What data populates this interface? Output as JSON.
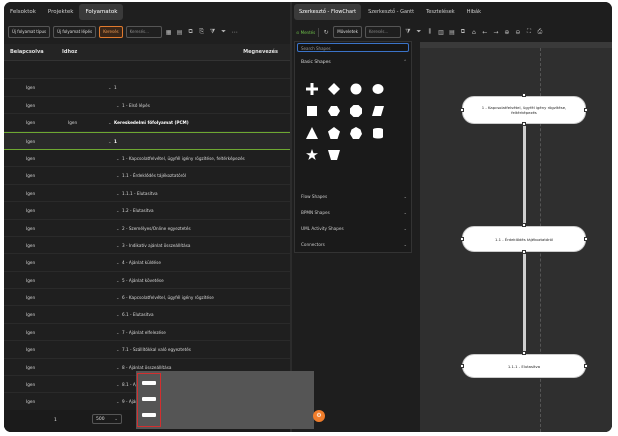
{
  "left": {
    "tabs": [
      "Felsoktok",
      "Projektek",
      "Folyamatok"
    ],
    "active_tab": "Folyamatok",
    "toolbar": {
      "btn1": "Új folyamat típus",
      "btn2": "Új folyamat lépés",
      "btn3": "Keresés",
      "search_placeholder": "Keresés..."
    },
    "columns": [
      "Beiapcsolva",
      "Idhoz",
      "Megnevezés"
    ],
    "rows": [
      {
        "c1": "",
        "c2": "",
        "name": "",
        "bold": false
      },
      {
        "c1": "Igen",
        "c2": "",
        "name": "1",
        "bold": false
      },
      {
        "c1": "Igen",
        "c2": "",
        "name": "1 - Első lépés",
        "bold": false
      },
      {
        "c1": "Igen",
        "c2": "Igen",
        "name": "Kereskedelmi főfolyamat (PCM)",
        "bold": true
      },
      {
        "c1": "Igen",
        "c2": "",
        "name": "1",
        "bold": true
      },
      {
        "c1": "Igen",
        "c2": "",
        "name": "1 - Kapcsolatfelvétel, ügyfél igény rögzítése, feltérképezés",
        "bold": false
      },
      {
        "c1": "Igen",
        "c2": "",
        "name": "1.1 - Érdeklődés tájékoztatóról",
        "bold": false
      },
      {
        "c1": "Igen",
        "c2": "",
        "name": "1.1.1 - Elutasítva",
        "bold": false
      },
      {
        "c1": "Igen",
        "c2": "",
        "name": "1.2 - Elutasítva",
        "bold": false
      },
      {
        "c1": "Igen",
        "c2": "",
        "name": "2 - Személyes/Online egyeztetés",
        "bold": false
      },
      {
        "c1": "Igen",
        "c2": "",
        "name": "3 - Indikatív ajánlat összeállítása",
        "bold": false
      },
      {
        "c1": "Igen",
        "c2": "",
        "name": "4 - Ajánlat küldése",
        "bold": false
      },
      {
        "c1": "Igen",
        "c2": "",
        "name": "5 - Ajánlat követése",
        "bold": false
      },
      {
        "c1": "Igen",
        "c2": "",
        "name": "6 - Kapcsolatfelvétel, ügyfél igény rögzítése",
        "bold": false
      },
      {
        "c1": "Igen",
        "c2": "",
        "name": "6.1 - Elutasítva",
        "bold": false
      },
      {
        "c1": "Igen",
        "c2": "",
        "name": "7 - Ajánlat elfelezése",
        "bold": false
      },
      {
        "c1": "Igen",
        "c2": "",
        "name": "7.1 - Szállítókkal való egyeztetés",
        "bold": false
      },
      {
        "c1": "Igen",
        "c2": "",
        "name": "8 - Ajánlat összeállítása",
        "bold": false
      },
      {
        "c1": "Igen",
        "c2": "",
        "name": "8.1 - Ajánlat jóváhagyása",
        "bold": false
      },
      {
        "c1": "Igen",
        "c2": "",
        "name": "9 - Ajánlat küldése",
        "bold": false
      },
      {
        "c1": "Igen",
        "c2": "",
        "name": "10 - Ajánlat követése",
        "bold": false
      }
    ],
    "footer": {
      "page": "1",
      "page_size": "500",
      "count": "1 / 1 (303 sor)"
    }
  },
  "right": {
    "tabs": [
      "Szerkesztő - FlowChart",
      "Szerkesztő - Gantt",
      "Tesztelések",
      "Hibák"
    ],
    "active_tab": "Szerkesztő - FlowChart",
    "toolbar": {
      "save": "Mentés",
      "mode": "Műveletek",
      "search_placeholder": "Keresés..."
    },
    "shapes_panel": {
      "search_placeholder": "Search Shapes",
      "basic": "Basic Shapes",
      "groups": [
        "Flow Shapes",
        "BPMN Shapes",
        "UML Activity Shapes",
        "Connectors"
      ]
    },
    "nodes": [
      "1 - Kapcsolatfelvétel, ügyfél igény rögzítése, feltérképezés",
      "1.1 - Érdeklődés tájékoztatóról",
      "1.1.1 - Elutasítva"
    ]
  }
}
